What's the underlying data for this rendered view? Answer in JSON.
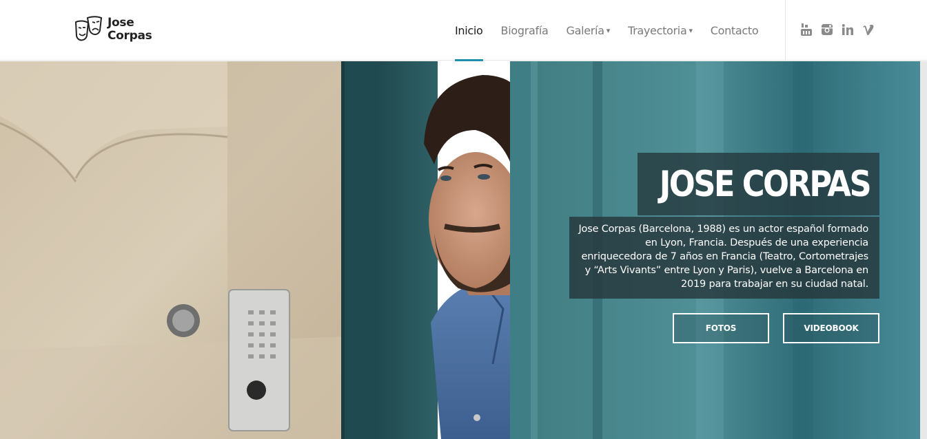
{
  "header": {
    "logo": {
      "line1": "Jose",
      "line2": "Corpas",
      "icon": "theater-masks-icon"
    },
    "nav": [
      {
        "label": "Inicio",
        "active": true,
        "dropdown": false
      },
      {
        "label": "Biografía",
        "active": false,
        "dropdown": false
      },
      {
        "label": "Galería",
        "active": false,
        "dropdown": true
      },
      {
        "label": "Trayectoria",
        "active": false,
        "dropdown": true
      },
      {
        "label": "Contacto",
        "active": false,
        "dropdown": false
      }
    ],
    "caret": "▾",
    "social": [
      "youtube-icon",
      "instagram-icon",
      "linkedin-icon",
      "vimeo-icon"
    ]
  },
  "hero": {
    "title": "JOSE CORPAS",
    "description": "Jose Corpas (Barcelona, 1988) es un actor español formado en Lyon, Francia. Después de una experiencia enriquecedora de 7 años en Francia (Teatro, Cortometrajes y “Arts Vivants” entre Lyon y Paris), vuelve a Barcelona en 2019 para trabajar en su ciudad natal.",
    "buttons": {
      "fotos": "FOTOS",
      "videobook": "VIDEOBOOK"
    }
  },
  "colors": {
    "accent": "#1f8fb0",
    "overlay": "#263a40",
    "nav_text": "#7a7a7a",
    "nav_active": "#1b1b1b"
  }
}
